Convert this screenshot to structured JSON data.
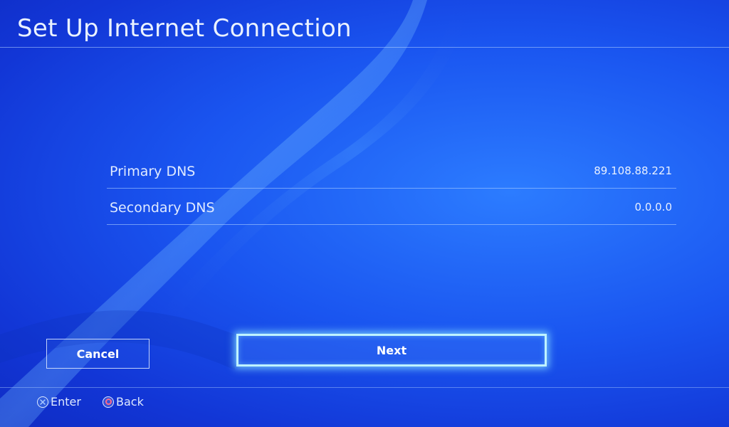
{
  "page": {
    "title": "Set Up Internet Connection"
  },
  "dns": {
    "rows": [
      {
        "label": "Primary DNS",
        "value": "89.108.88.221"
      },
      {
        "label": "Secondary DNS",
        "value": "0.0.0.0"
      }
    ]
  },
  "buttons": {
    "cancel_label": "Cancel",
    "next_label": "Next"
  },
  "footer": {
    "enter_label": "Enter",
    "back_label": "Back",
    "enter_icon": "cross-button-icon",
    "back_icon": "circle-button-icon"
  },
  "colors": {
    "background": "#1a55f0",
    "focus_glow": "#bff3ff",
    "circle_button": "#ff6a8a"
  }
}
